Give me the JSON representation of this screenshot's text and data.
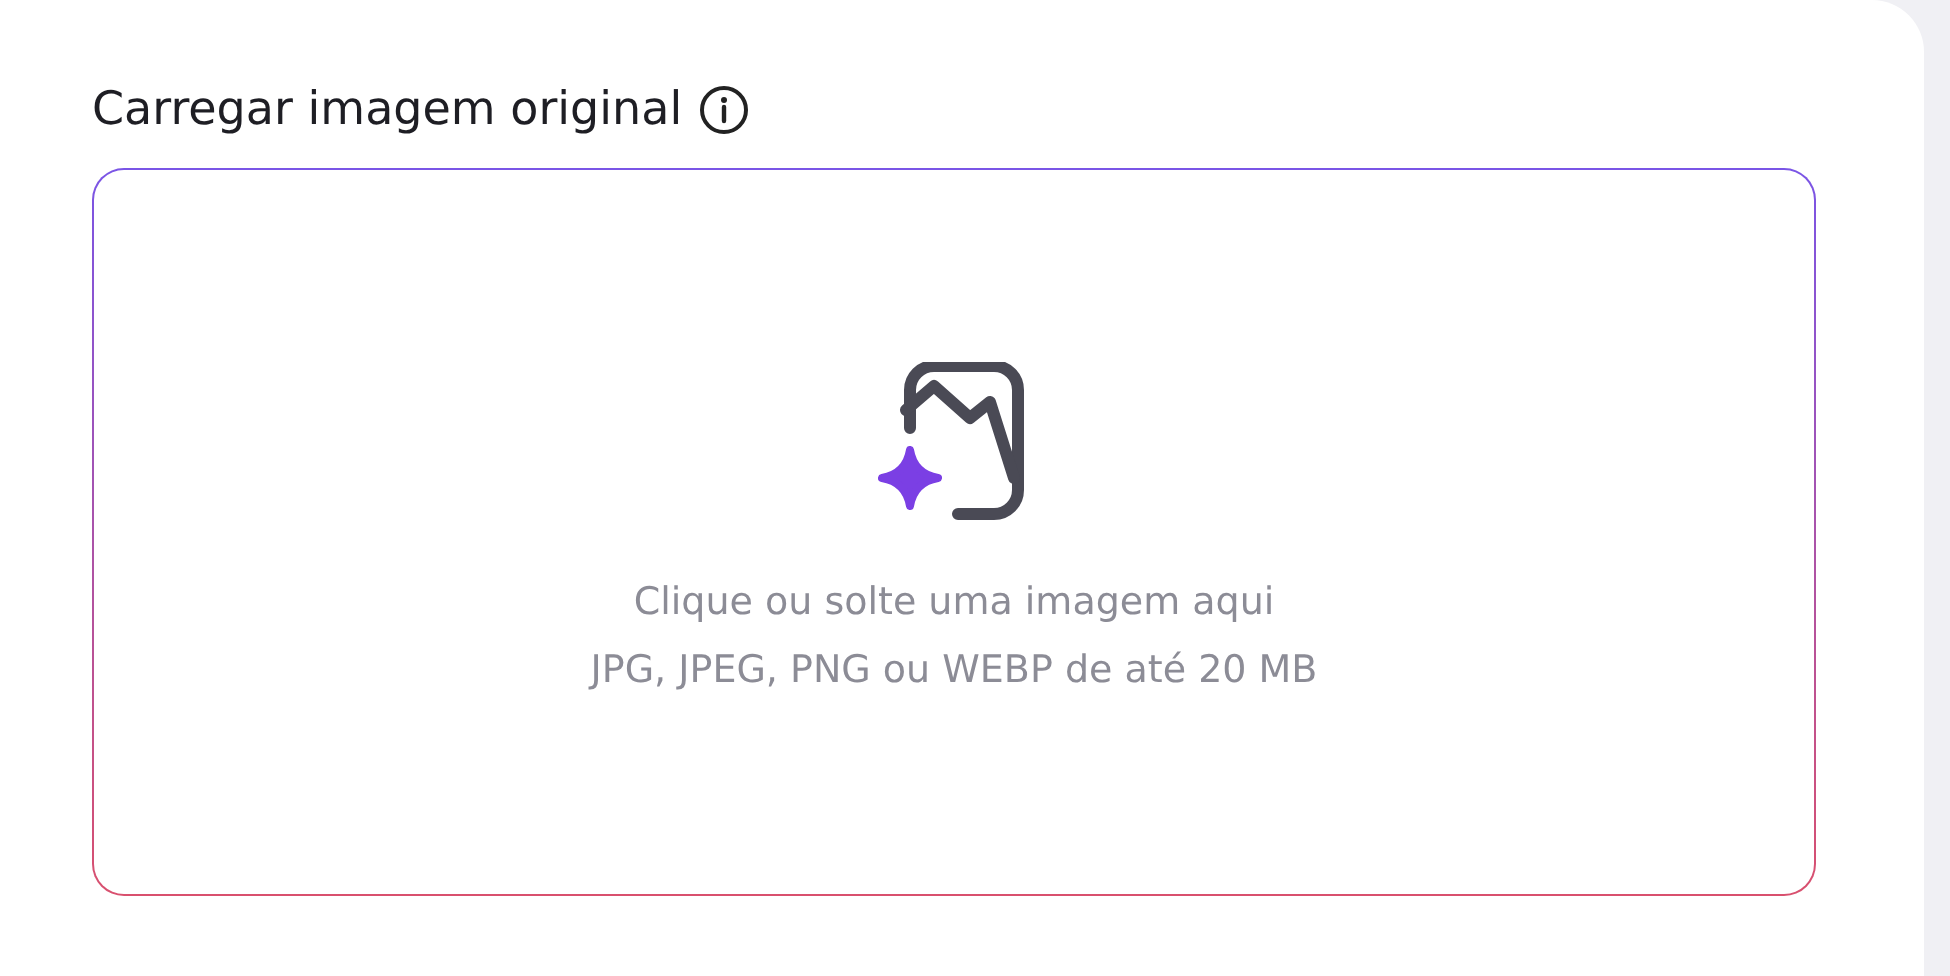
{
  "upload": {
    "title": "Carregar imagem original",
    "dropzone": {
      "prompt": "Clique ou solte uma imagem aqui",
      "hint": "JPG, JPEG, PNG ou WEBP de até 20 MB"
    }
  }
}
